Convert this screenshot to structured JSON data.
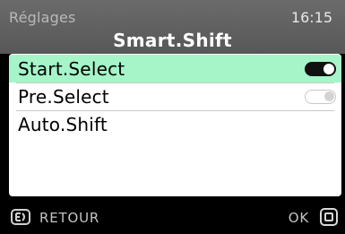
{
  "header": {
    "breadcrumb": "Réglages",
    "clock": "16:15",
    "title": "Smart.Shift"
  },
  "menu": {
    "items": [
      {
        "label": "Start.Select",
        "toggle": true,
        "selected": true
      },
      {
        "label": "Pre.Select",
        "toggle": false,
        "selected": false
      },
      {
        "label": "Auto.Shift",
        "selected": false
      }
    ]
  },
  "footer": {
    "back_label": "RETOUR",
    "ok_label": "OK",
    "back_icon": "back-icon",
    "ok_icon": "ok-square-icon"
  },
  "colors": {
    "header_bg": "#616161",
    "highlight": "#a5f5c9",
    "footer_bg": "#000000"
  }
}
